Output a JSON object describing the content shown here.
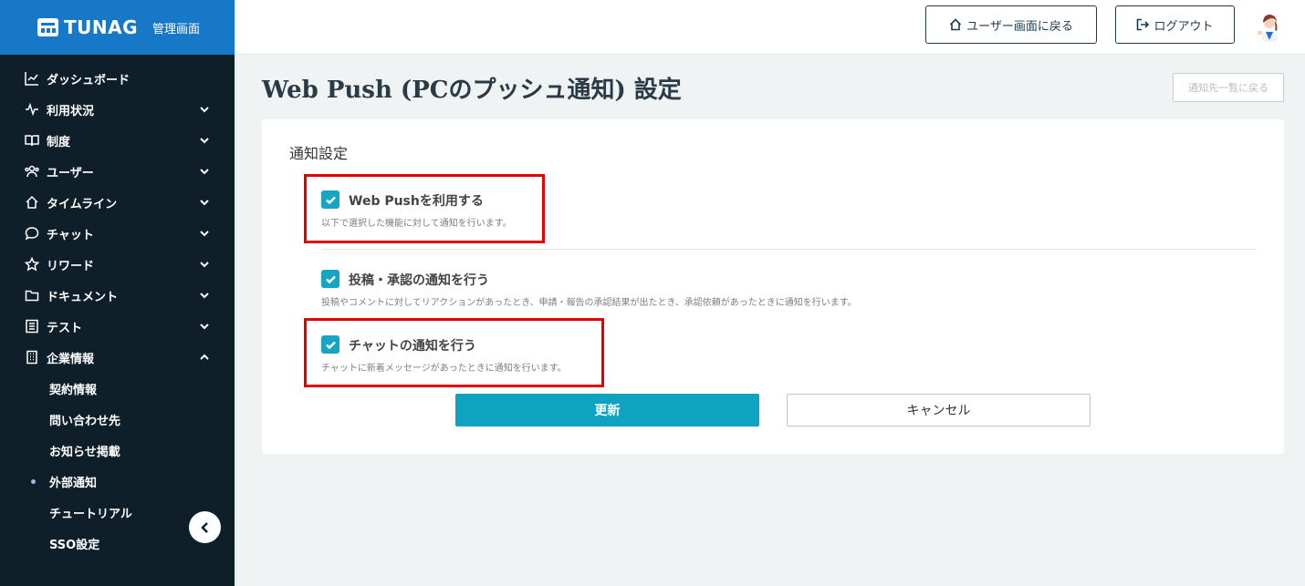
{
  "brand": {
    "name": "TUNAG",
    "sub": "管理画面"
  },
  "header": {
    "user_screen_label": "ユーザー画面に戻る",
    "logout_label": "ログアウト"
  },
  "sidebar": {
    "items": [
      {
        "label": "ダッシュボード",
        "icon": "chart-icon",
        "expand": "none"
      },
      {
        "label": "利用状況",
        "icon": "pulse-icon",
        "expand": "down"
      },
      {
        "label": "制度",
        "icon": "book-icon",
        "expand": "down"
      },
      {
        "label": "ユーザー",
        "icon": "users-icon",
        "expand": "down"
      },
      {
        "label": "タイムライン",
        "icon": "home-icon",
        "expand": "down"
      },
      {
        "label": "チャット",
        "icon": "chat-icon",
        "expand": "down"
      },
      {
        "label": "リワード",
        "icon": "star-icon",
        "expand": "down"
      },
      {
        "label": "ドキュメント",
        "icon": "folder-icon",
        "expand": "down"
      },
      {
        "label": "テスト",
        "icon": "list-icon",
        "expand": "down"
      },
      {
        "label": "企業情報",
        "icon": "building-icon",
        "expand": "up"
      }
    ],
    "sub_items": [
      {
        "label": "契約情報",
        "active": false
      },
      {
        "label": "問い合わせ先",
        "active": false
      },
      {
        "label": "お知らせ掲載",
        "active": false
      },
      {
        "label": "外部通知",
        "active": true
      },
      {
        "label": "チュートリアル",
        "active": false
      },
      {
        "label": "SSO設定",
        "active": false
      }
    ]
  },
  "page": {
    "title": "Web Push (PCのプッシュ通知) 設定",
    "back_list_label": "通知先一覧に戻る",
    "section_title": "通知設定",
    "options": [
      {
        "label": "Web Pushを利用する",
        "desc": "以下で選択した機能に対して通知を行います。",
        "checked": true
      },
      {
        "label": "投稿・承認の通知を行う",
        "desc": "投稿やコメントに対してリアクションがあったとき、申請・報告の承認結果が出たとき、承認依頼があったときに通知を行います。",
        "checked": true
      },
      {
        "label": "チャットの通知を行う",
        "desc": "チャットに新着メッセージがあったときに通知を行います。",
        "checked": true
      }
    ],
    "submit_label": "更新",
    "cancel_label": "キャンセル"
  },
  "colors": {
    "sidebar_bg": "#0e1f2a",
    "brand_bg": "#1878c8",
    "accent": "#0ea4c1",
    "highlight": "#e50000"
  }
}
